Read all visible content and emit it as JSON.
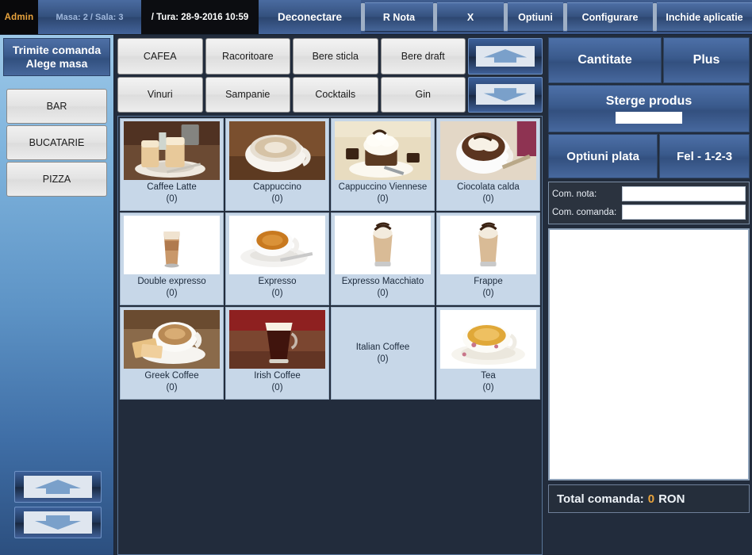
{
  "topbar": {
    "admin": "Admin",
    "mesa": "Masa: 2 / Sala: 3",
    "tura": "/ Tura: 28-9-2016 10:59",
    "deconectare": "Deconectare",
    "r_nota": "R Nota",
    "x": "X",
    "optiuni": "Optiuni",
    "configurare": "Configurare",
    "inchide": "Inchide aplicatie"
  },
  "sidebar": {
    "header_line1": "Trimite comanda",
    "header_line2": "Alege masa",
    "departments": [
      {
        "label": "BAR"
      },
      {
        "label": "BUCATARIE"
      },
      {
        "label": "PIZZA"
      }
    ],
    "nav": {
      "up": "scroll-up",
      "down": "scroll-down"
    }
  },
  "categories": {
    "items": [
      {
        "label": "CAFEA",
        "selected": true
      },
      {
        "label": "Racoritoare",
        "selected": false
      },
      {
        "label": "Bere sticla",
        "selected": false
      },
      {
        "label": "Bere draft",
        "selected": false
      },
      {
        "label": "Vinuri",
        "selected": false
      },
      {
        "label": "Sampanie",
        "selected": false
      },
      {
        "label": "Cocktails",
        "selected": false
      },
      {
        "label": "Gin",
        "selected": false
      }
    ],
    "nav": {
      "up": "scroll-up",
      "down": "scroll-down"
    }
  },
  "products": [
    {
      "name": "Caffee Latte",
      "count": "(0)",
      "has_image": true,
      "image": "latte-glasses-photo"
    },
    {
      "name": "Cappuccino",
      "count": "(0)",
      "has_image": true,
      "image": "cappuccino-cup-photo"
    },
    {
      "name": "Cappuccino Viennese",
      "count": "(0)",
      "has_image": true,
      "image": "cappuccino-viennese-photo"
    },
    {
      "name": "Ciocolata calda",
      "count": "(0)",
      "has_image": true,
      "image": "hot-chocolate-photo"
    },
    {
      "name": "Double expresso",
      "count": "(0)",
      "has_image": true,
      "image": "double-espresso-glass-photo"
    },
    {
      "name": "Expresso",
      "count": "(0)",
      "has_image": true,
      "image": "espresso-cup-photo"
    },
    {
      "name": "Expresso Macchiato",
      "count": "(0)",
      "has_image": true,
      "image": "macchiato-glass-photo"
    },
    {
      "name": "Frappe",
      "count": "(0)",
      "has_image": true,
      "image": "frappe-glass-photo"
    },
    {
      "name": "Greek Coffee",
      "count": "(0)",
      "has_image": true,
      "image": "greek-coffee-photo"
    },
    {
      "name": "Irish Coffee",
      "count": "(0)",
      "has_image": true,
      "image": "irish-coffee-photo"
    },
    {
      "name": "Italian Coffee",
      "count": "(0)",
      "has_image": false,
      "image": ""
    },
    {
      "name": "Tea",
      "count": "(0)",
      "has_image": true,
      "image": "tea-cup-photo"
    }
  ],
  "right": {
    "cantitate": "Cantitate",
    "plus": "Plus",
    "sterge_produs": "Sterge produs",
    "sterge_value": "",
    "optiuni_plata": "Optiuni plata",
    "fel": "Fel - 1-2-3",
    "com_nota_label": "Com. nota:",
    "com_nota_value": "",
    "com_comanda_label": "Com. comanda:",
    "com_comanda_value": "",
    "total_label": "Total comanda:",
    "total_amount": "0",
    "total_currency": "RON"
  },
  "colors": {
    "accent_gold": "#e8a33d",
    "panel_dark": "#222c3c",
    "button_blue": "#3a5a8c",
    "tile_bg": "#c7d7e8"
  }
}
